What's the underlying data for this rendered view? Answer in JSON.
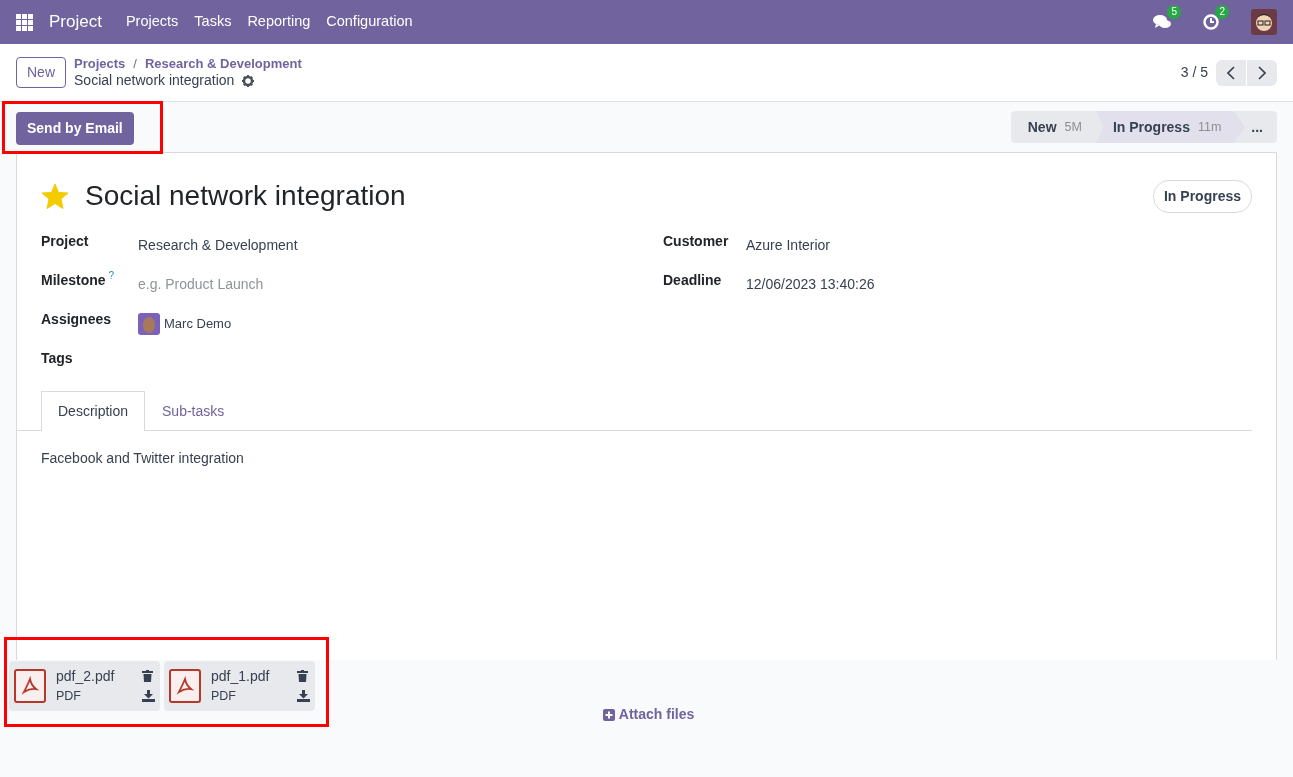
{
  "navbar": {
    "app_name": "Project",
    "menu": [
      "Projects",
      "Tasks",
      "Reporting",
      "Configuration"
    ],
    "messages_count": "5",
    "activities_count": "2"
  },
  "control_panel": {
    "new_button": "New",
    "breadcrumbs": [
      "Projects",
      "Research & Development"
    ],
    "breadcrumb_separator": "/",
    "current": "Social network integration",
    "pager": "3 / 5"
  },
  "actions": [
    {
      "label": "Send by Email",
      "highlighted": true
    }
  ],
  "stages": [
    {
      "label": "New",
      "duration": "5M",
      "selected": false
    },
    {
      "label": "In Progress",
      "duration": "11m",
      "selected": true
    }
  ],
  "stages_more": "...",
  "task": {
    "starred": true,
    "title": "Social network integration",
    "status": "In Progress"
  },
  "fields_left": [
    {
      "label": "Project",
      "value": "Research & Development"
    },
    {
      "label": "Milestone",
      "help": "?",
      "placeholder": "e.g. Product Launch"
    },
    {
      "label": "Assignees",
      "value": "Marc Demo",
      "kind": "avatar"
    },
    {
      "label": "Tags"
    }
  ],
  "fields_right": [
    {
      "label": "Customer",
      "value": "Azure Interior"
    },
    {
      "label": "Deadline",
      "value": "12/06/2023 13:40:26"
    }
  ],
  "tabs": [
    {
      "label": "Description",
      "selected": true
    },
    {
      "label": "Sub-tasks",
      "selected": false
    }
  ],
  "description": "Facebook and Twitter integration",
  "attachments": {
    "highlighted": true,
    "files": [
      {
        "name": "pdf_2.pdf",
        "type": "PDF"
      },
      {
        "name": "pdf_1.pdf",
        "type": "PDF"
      }
    ]
  },
  "attach_button": "Attach files"
}
